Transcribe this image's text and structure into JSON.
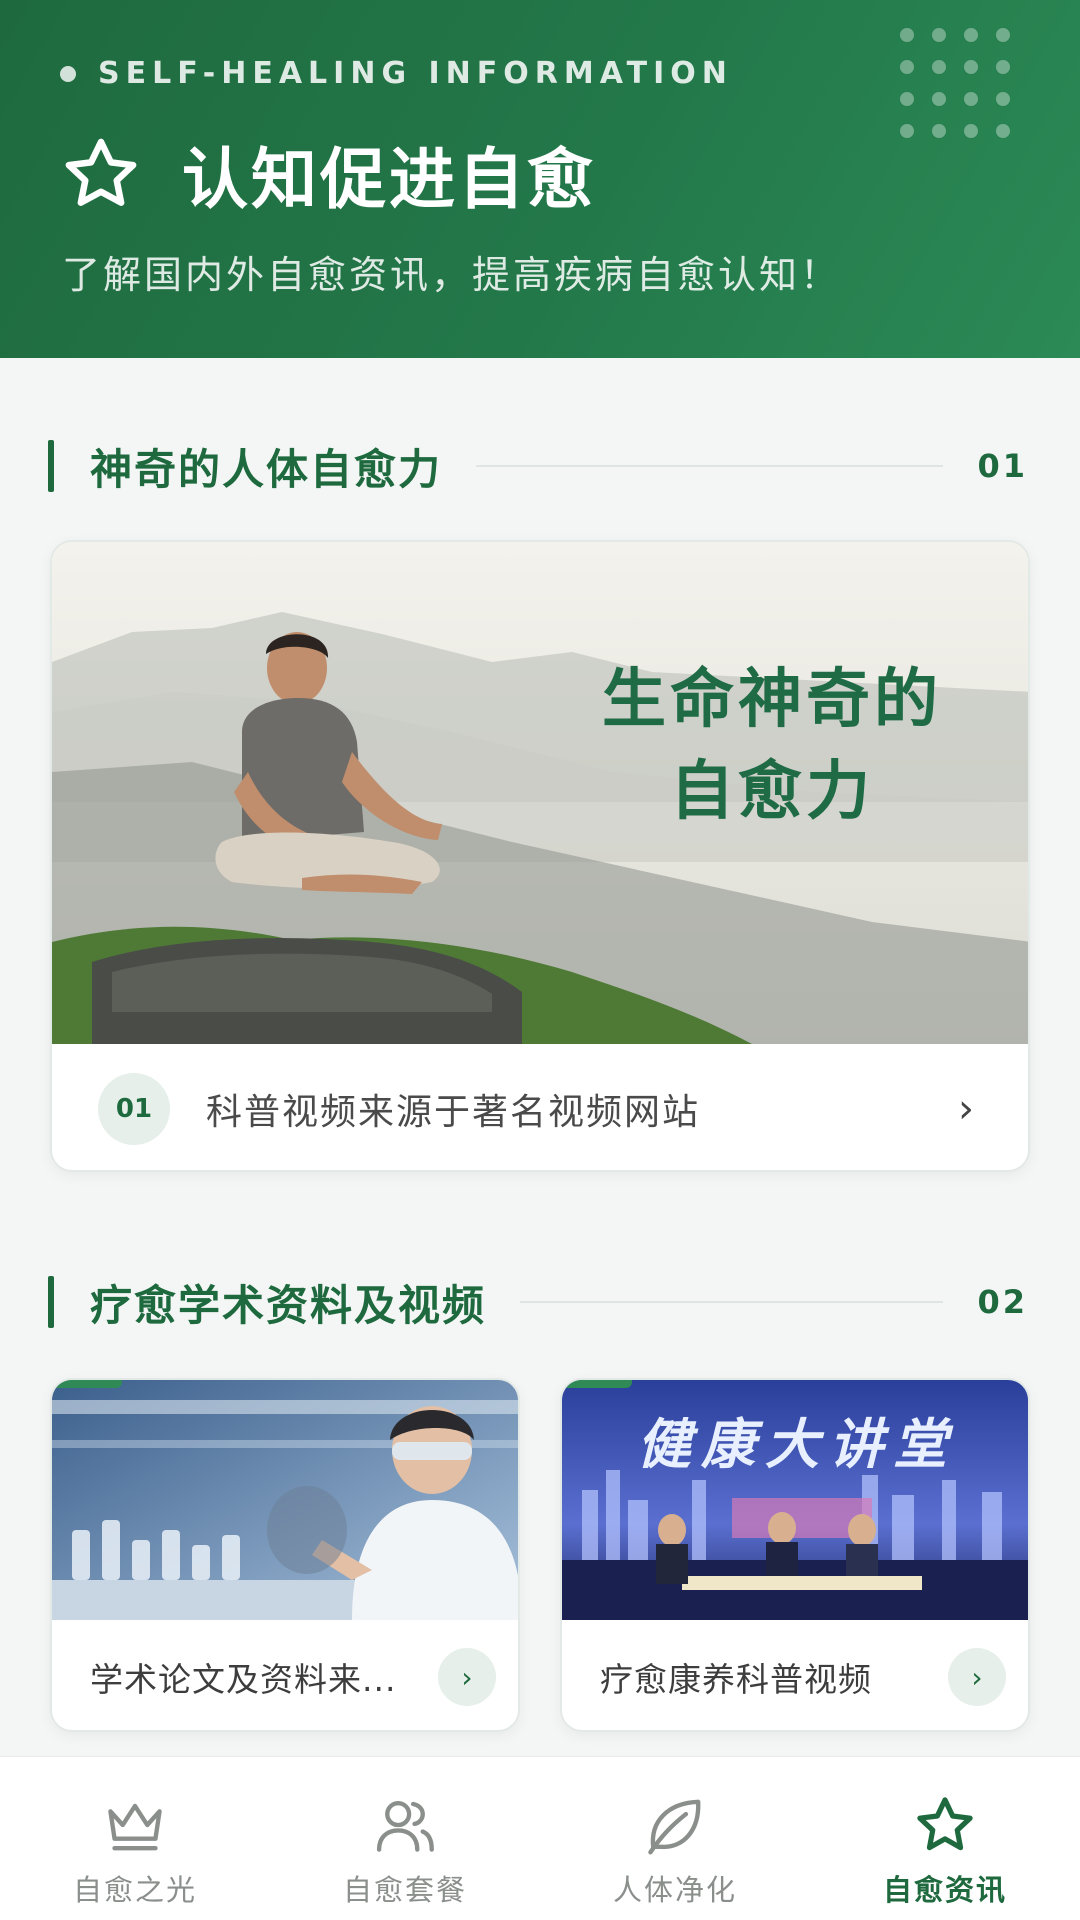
{
  "header": {
    "eyebrow": "SELF-HEALING INFORMATION",
    "title": "认知促进自愈",
    "subtitle": "了解国内外自愈资讯，提高疾病自愈认知！",
    "icon": "star-icon"
  },
  "sections": [
    {
      "title": "神奇的人体自愈力",
      "number": "01"
    },
    {
      "title": "疗愈学术资料及视频",
      "number": "02"
    }
  ],
  "feature_card": {
    "image_caption_line1": "生命神奇的",
    "image_caption_line2": "自愈力",
    "badge": "01",
    "text": "科普视频来源于著名视频网站",
    "chevron": "›"
  },
  "cards": [
    {
      "text": "学术论文及资料来...",
      "arrow": "›"
    },
    {
      "text": "疗愈康养科普视频",
      "arrow": "›",
      "thumb_title": "健康大讲堂"
    }
  ],
  "nav": [
    {
      "label": "自愈之光",
      "icon": "crown-icon",
      "active": false
    },
    {
      "label": "自愈套餐",
      "icon": "users-icon",
      "active": false
    },
    {
      "label": "人体净化",
      "icon": "leaf-icon",
      "active": false
    },
    {
      "label": "自愈资讯",
      "icon": "star-icon",
      "active": true
    }
  ],
  "colors": {
    "brand": "#1e6a3e",
    "accent": "#2f8a55",
    "inactive": "#8a8f8c"
  }
}
